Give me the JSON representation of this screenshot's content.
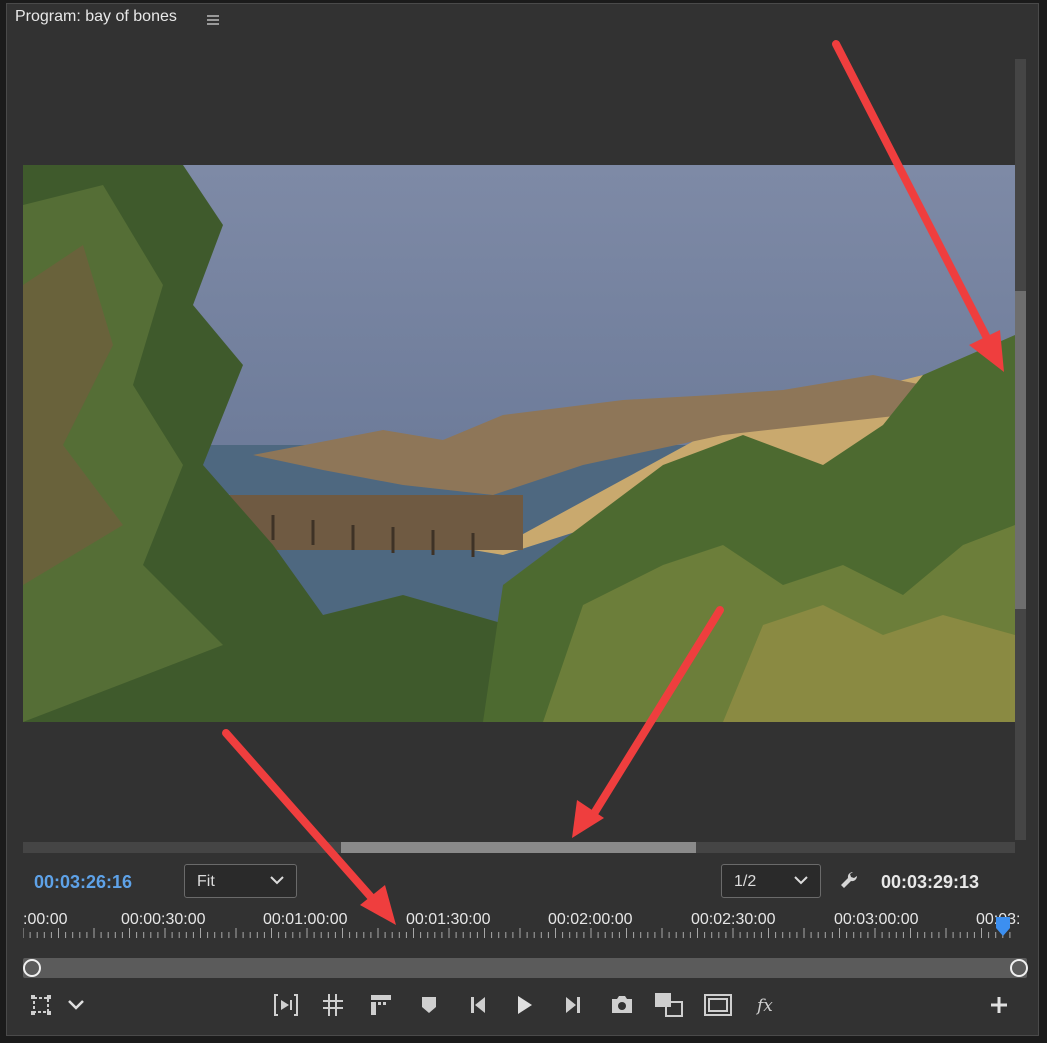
{
  "panel": {
    "title": "Program: bay of bones",
    "menu_icon": "hamburger-icon"
  },
  "timecode": {
    "current": "00:03:26:16",
    "duration": "00:03:29:13"
  },
  "zoom_dropdown": {
    "selected": "Fit"
  },
  "resolution_dropdown": {
    "selected": "1/2"
  },
  "ruler": {
    "labels": [
      ":00:00",
      "00:00:30:00",
      "00:01:00:00",
      "00:01:30:00",
      "00:02:00:00",
      "00:02:30:00",
      "00:03:00:00",
      "00:03:"
    ]
  },
  "controls": {
    "left": [
      "safe-margins-icon",
      "chevron-down-icon"
    ],
    "center": [
      "mark-in-out-icon",
      "grid-icon",
      "insert-icon",
      "add-marker-icon",
      "step-back-icon",
      "play-icon",
      "step-forward-icon",
      "export-frame-icon",
      "compare-view-icon",
      "overlay-icon",
      "fx-icon"
    ],
    "right": [
      "plus-icon"
    ]
  },
  "colors": {
    "accent_timecode": "#5ea2e8",
    "playhead": "#3c8ff0",
    "annotation_arrows": "#ef3e3e"
  }
}
